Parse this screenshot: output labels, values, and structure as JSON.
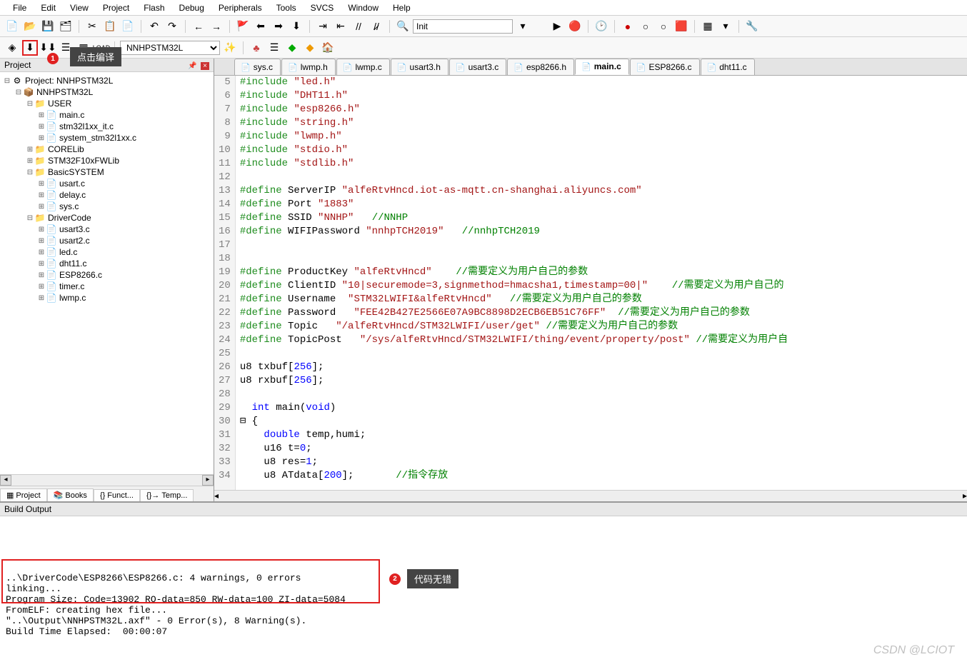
{
  "menus": [
    "File",
    "Edit",
    "View",
    "Project",
    "Flash",
    "Debug",
    "Peripherals",
    "Tools",
    "SVCS",
    "Window",
    "Help"
  ],
  "toolbar1": {
    "init_text": "Init"
  },
  "toolbar2": {
    "target": "NNHPSTM32L"
  },
  "annotations": {
    "badge1": "1",
    "tip1": "点击编译",
    "badge2": "2",
    "tip2": "代码无错"
  },
  "project_panel": {
    "title": "Project",
    "tabs": [
      "Project",
      "Books",
      "Funct...",
      "Temp..."
    ],
    "tree": [
      {
        "ind": 0,
        "exp": "⊟",
        "icon": "⚙",
        "label": "Project: NNHPSTM32L"
      },
      {
        "ind": 1,
        "exp": "⊟",
        "icon": "📦",
        "label": "NNHPSTM32L"
      },
      {
        "ind": 2,
        "exp": "⊟",
        "icon": "📁",
        "label": "USER"
      },
      {
        "ind": 3,
        "exp": "⊞",
        "icon": "📄",
        "label": "main.c"
      },
      {
        "ind": 3,
        "exp": "⊞",
        "icon": "📄",
        "label": "stm32l1xx_it.c"
      },
      {
        "ind": 3,
        "exp": "⊞",
        "icon": "📄",
        "label": "system_stm32l1xx.c"
      },
      {
        "ind": 2,
        "exp": "⊞",
        "icon": "📁",
        "label": "CORELib"
      },
      {
        "ind": 2,
        "exp": "⊞",
        "icon": "📁",
        "label": "STM32F10xFWLib"
      },
      {
        "ind": 2,
        "exp": "⊟",
        "icon": "📁",
        "label": "BasicSYSTEM"
      },
      {
        "ind": 3,
        "exp": "⊞",
        "icon": "📄",
        "label": "usart.c"
      },
      {
        "ind": 3,
        "exp": "⊞",
        "icon": "📄",
        "label": "delay.c"
      },
      {
        "ind": 3,
        "exp": "⊞",
        "icon": "📄",
        "label": "sys.c"
      },
      {
        "ind": 2,
        "exp": "⊟",
        "icon": "📁",
        "label": "DriverCode"
      },
      {
        "ind": 3,
        "exp": "⊞",
        "icon": "📄",
        "label": "usart3.c"
      },
      {
        "ind": 3,
        "exp": "⊞",
        "icon": "📄",
        "label": "usart2.c"
      },
      {
        "ind": 3,
        "exp": "⊞",
        "icon": "📄",
        "label": "led.c"
      },
      {
        "ind": 3,
        "exp": "⊞",
        "icon": "📄",
        "label": "dht11.c"
      },
      {
        "ind": 3,
        "exp": "⊞",
        "icon": "📄",
        "label": "ESP8266.c"
      },
      {
        "ind": 3,
        "exp": "⊞",
        "icon": "📄",
        "label": "timer.c"
      },
      {
        "ind": 3,
        "exp": "⊞",
        "icon": "📄",
        "label": "lwmp.c"
      }
    ]
  },
  "file_tabs": [
    {
      "name": "sys.c",
      "t": "c"
    },
    {
      "name": "lwmp.h",
      "t": "h"
    },
    {
      "name": "lwmp.c",
      "t": "c"
    },
    {
      "name": "usart3.h",
      "t": "h"
    },
    {
      "name": "usart3.c",
      "t": "c"
    },
    {
      "name": "esp8266.h",
      "t": "h"
    },
    {
      "name": "main.c",
      "t": "c",
      "active": true
    },
    {
      "name": "ESP8266.c",
      "t": "c"
    },
    {
      "name": "dht11.c",
      "t": "c"
    }
  ],
  "code": [
    {
      "n": 5,
      "html": "<span class='tok-pre'>#include</span> <span class='tok-str'>\"led.h\"</span>"
    },
    {
      "n": 6,
      "html": "<span class='tok-pre'>#include</span> <span class='tok-str'>\"DHT11.h\"</span>"
    },
    {
      "n": 7,
      "html": "<span class='tok-pre'>#include</span> <span class='tok-str'>\"esp8266.h\"</span>"
    },
    {
      "n": 8,
      "html": "<span class='tok-pre'>#include</span> <span class='tok-str'>\"string.h\"</span>"
    },
    {
      "n": 9,
      "html": "<span class='tok-pre'>#include</span> <span class='tok-str'>\"lwmp.h\"</span>"
    },
    {
      "n": 10,
      "html": "<span class='tok-pre'>#include</span> <span class='tok-str'>\"stdio.h\"</span>"
    },
    {
      "n": 11,
      "html": "<span class='tok-pre'>#include</span> <span class='tok-str'>\"stdlib.h\"</span>"
    },
    {
      "n": 12,
      "html": ""
    },
    {
      "n": 13,
      "html": "<span class='tok-pre'>#define</span> ServerIP <span class='tok-str'>\"alfeRtvHncd.iot-as-mqtt.cn-shanghai.aliyuncs.com\"</span>"
    },
    {
      "n": 14,
      "html": "<span class='tok-pre'>#define</span> Port <span class='tok-str'>\"1883\"</span>"
    },
    {
      "n": 15,
      "html": "<span class='tok-pre'>#define</span> SSID <span class='tok-str'>\"NNHP\"</span>   <span class='tok-cmt'>//NNHP</span>"
    },
    {
      "n": 16,
      "html": "<span class='tok-pre'>#define</span> WIFIPassword <span class='tok-str'>\"nnhpTCH2019\"</span>   <span class='tok-cmt'>//nnhpTCH2019</span>"
    },
    {
      "n": 17,
      "html": ""
    },
    {
      "n": 18,
      "html": ""
    },
    {
      "n": 19,
      "html": "<span class='tok-pre'>#define</span> ProductKey <span class='tok-str'>\"alfeRtvHncd\"</span>    <span class='tok-cmt'>//需要定义为用户自己的参数</span>"
    },
    {
      "n": 20,
      "html": "<span class='tok-pre'>#define</span> ClientID <span class='tok-str'>\"10|securemode=3,signmethod=hmacsha1,timestamp=00|\"</span>    <span class='tok-cmt'>//需要定义为用户自己的</span>"
    },
    {
      "n": 21,
      "html": "<span class='tok-pre'>#define</span> Username  <span class='tok-str'>\"STM32LWIFI&alfeRtvHncd\"</span>   <span class='tok-cmt'>//需要定义为用户自己的参数</span>"
    },
    {
      "n": 22,
      "html": "<span class='tok-pre'>#define</span> Password   <span class='tok-str'>\"FEE42B427E2566E07A9BC8898D2ECB6EB51C76FF\"</span>  <span class='tok-cmt'>//需要定义为用户自己的参数</span>"
    },
    {
      "n": 23,
      "html": "<span class='tok-pre'>#define</span> Topic   <span class='tok-str'>\"/alfeRtvHncd/STM32LWIFI/user/get\"</span> <span class='tok-cmt'>//需要定义为用户自己的参数</span>"
    },
    {
      "n": 24,
      "html": "<span class='tok-pre'>#define</span> TopicPost   <span class='tok-str'>\"/sys/alfeRtvHncd/STM32LWIFI/thing/event/property/post\"</span> <span class='tok-cmt'>//需要定义为用户自</span>"
    },
    {
      "n": 25,
      "html": ""
    },
    {
      "n": 26,
      "html": "u8 txbuf[<span class='tok-num'>256</span>];"
    },
    {
      "n": 27,
      "html": "u8 rxbuf[<span class='tok-num'>256</span>];"
    },
    {
      "n": 28,
      "html": ""
    },
    {
      "n": 29,
      "html": "  <span class='tok-kw'>int</span> main(<span class='tok-kw'>void</span>)"
    },
    {
      "n": 30,
      "html": "⊟ {"
    },
    {
      "n": 31,
      "html": "    <span class='tok-kw'>double</span> temp,humi;"
    },
    {
      "n": 32,
      "html": "    u16 t=<span class='tok-num'>0</span>;"
    },
    {
      "n": 33,
      "html": "    u8 res=<span class='tok-num'>1</span>;"
    },
    {
      "n": 34,
      "html": "    u8 ATdata[<span class='tok-num'>200</span>];       <span class='tok-cmt'>//指令存放</span>"
    }
  ],
  "build": {
    "title": "Build Output",
    "lines": [
      "..\\DriverCode\\ESP8266\\ESP8266.c: 4 warnings, 0 errors",
      "linking...",
      "Program Size: Code=13902 RO-data=850 RW-data=100 ZI-data=5084",
      "FromELF: creating hex file...",
      "\"..\\Output\\NNHPSTM32L.axf\" - 0 Error(s), 8 Warning(s).",
      "Build Time Elapsed:  00:00:07"
    ]
  },
  "watermark": "CSDN @LCIOT"
}
